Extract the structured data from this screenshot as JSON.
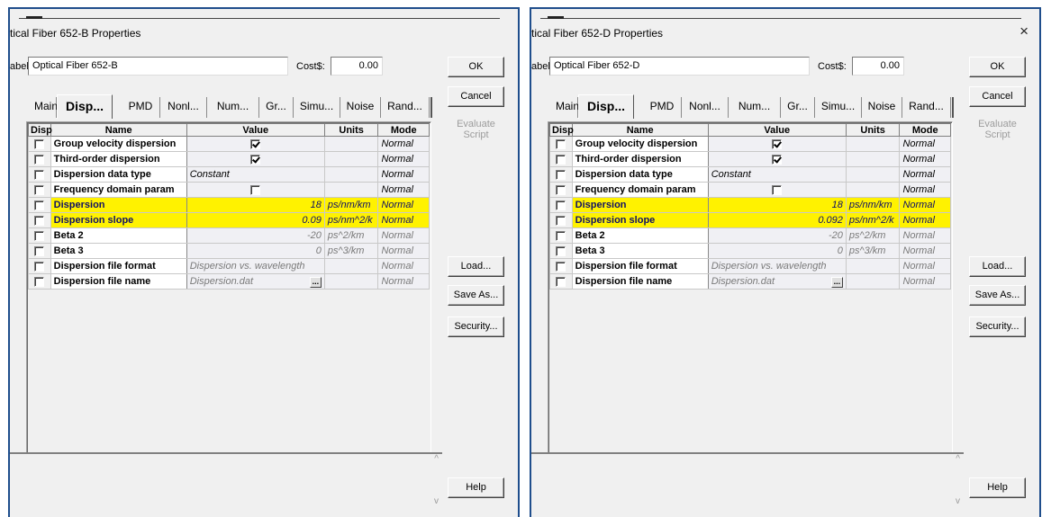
{
  "panels": [
    {
      "title": "tical Fiber 652-B Properties",
      "label_caption": "abel:",
      "label_value": "Optical Fiber 652-B",
      "cost_caption": "Cost$:",
      "cost_value": "0.00",
      "tabs": [
        "Main",
        "Disp...",
        "PMD",
        "Nonl...",
        "Num...",
        "Gr...",
        "Simu...",
        "Noise",
        "Rand..."
      ],
      "active_tab": 1,
      "columns": [
        "Disp",
        "Name",
        "Value",
        "Units",
        "Mode"
      ],
      "rows": [
        {
          "name": "Group velocity dispersion",
          "value": "",
          "check": true,
          "units": "",
          "mode": "Normal",
          "hl": false,
          "dim": false
        },
        {
          "name": "Third-order dispersion",
          "value": "",
          "check": true,
          "units": "",
          "mode": "Normal",
          "hl": false,
          "dim": false
        },
        {
          "name": "Dispersion data type",
          "value": "Constant",
          "units": "",
          "mode": "Normal",
          "hl": false,
          "dim": false
        },
        {
          "name": "Frequency domain param",
          "value": "",
          "check": false,
          "units": "",
          "mode": "Normal",
          "hl": false,
          "dim": false
        },
        {
          "name": "Dispersion",
          "value": "18",
          "num": true,
          "units": "ps/nm/km",
          "mode": "Normal",
          "hl": true,
          "dim": false
        },
        {
          "name": "Dispersion slope",
          "value": "0.09",
          "num": true,
          "units": "ps/nm^2/k",
          "mode": "Normal",
          "hl": true,
          "dim": false
        },
        {
          "name": "Beta 2",
          "value": "-20",
          "num": true,
          "units": "ps^2/km",
          "mode": "Normal",
          "hl": false,
          "dim": true
        },
        {
          "name": "Beta 3",
          "value": "0",
          "num": true,
          "units": "ps^3/km",
          "mode": "Normal",
          "hl": false,
          "dim": true
        },
        {
          "name": "Dispersion file format",
          "value": "Dispersion vs. wavelength",
          "units": "",
          "mode": "Normal",
          "hl": false,
          "dim": true
        },
        {
          "name": "Dispersion file name",
          "value": "Dispersion.dat",
          "browse": true,
          "units": "",
          "mode": "Normal",
          "hl": false,
          "dim": true
        }
      ],
      "buttons": {
        "ok": "OK",
        "cancel": "Cancel",
        "evaluate": "Evaluate Script",
        "load": "Load...",
        "save_as": "Save As...",
        "security": "Security...",
        "help": "Help"
      },
      "show_close": false
    },
    {
      "title": "tical Fiber 652-D Properties",
      "label_caption": "abel:",
      "label_value": "Optical Fiber 652-D",
      "cost_caption": "Cost$:",
      "cost_value": "0.00",
      "tabs": [
        "Main",
        "Disp...",
        "PMD",
        "Nonl...",
        "Num...",
        "Gr...",
        "Simu...",
        "Noise",
        "Rand..."
      ],
      "active_tab": 1,
      "columns": [
        "Disp",
        "Name",
        "Value",
        "Units",
        "Mode"
      ],
      "rows": [
        {
          "name": "Group velocity dispersion",
          "value": "",
          "check": true,
          "units": "",
          "mode": "Normal",
          "hl": false,
          "dim": false
        },
        {
          "name": "Third-order dispersion",
          "value": "",
          "check": true,
          "units": "",
          "mode": "Normal",
          "hl": false,
          "dim": false
        },
        {
          "name": "Dispersion data type",
          "value": "Constant",
          "units": "",
          "mode": "Normal",
          "hl": false,
          "dim": false
        },
        {
          "name": "Frequency domain param",
          "value": "",
          "check": false,
          "units": "",
          "mode": "Normal",
          "hl": false,
          "dim": false
        },
        {
          "name": "Dispersion",
          "value": "18",
          "num": true,
          "units": "ps/nm/km",
          "mode": "Normal",
          "hl": true,
          "dim": false
        },
        {
          "name": "Dispersion slope",
          "value": "0.092",
          "num": true,
          "units": "ps/nm^2/k",
          "mode": "Normal",
          "hl": true,
          "dim": false
        },
        {
          "name": "Beta 2",
          "value": "-20",
          "num": true,
          "units": "ps^2/km",
          "mode": "Normal",
          "hl": false,
          "dim": true
        },
        {
          "name": "Beta 3",
          "value": "0",
          "num": true,
          "units": "ps^3/km",
          "mode": "Normal",
          "hl": false,
          "dim": true
        },
        {
          "name": "Dispersion file format",
          "value": "Dispersion vs. wavelength",
          "units": "",
          "mode": "Normal",
          "hl": false,
          "dim": true
        },
        {
          "name": "Dispersion file name",
          "value": "Dispersion.dat",
          "browse": true,
          "units": "",
          "mode": "Normal",
          "hl": false,
          "dim": true
        }
      ],
      "buttons": {
        "ok": "OK",
        "cancel": "Cancel",
        "evaluate": "Evaluate Script",
        "load": "Load...",
        "save_as": "Save As...",
        "security": "Security...",
        "help": "Help"
      },
      "show_close": true,
      "close_glyph": "×"
    }
  ],
  "colors": {
    "highlight": "#fff200",
    "frame_border": "#1f4e8c",
    "dialog_bg": "#f0f0f0"
  },
  "icons": {
    "close": "close-icon",
    "browse": "browse-icon",
    "scroll_up": "scroll-up-icon",
    "scroll_down": "scroll-down-icon"
  }
}
